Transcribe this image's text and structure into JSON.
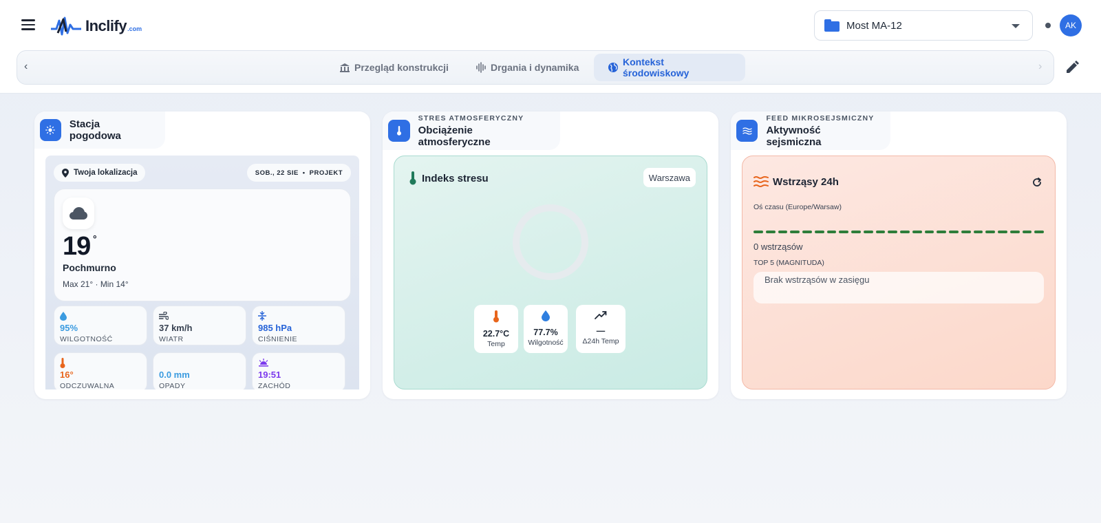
{
  "header": {
    "logo_text": "Inclify",
    "logo_suffix": ".com",
    "project": "Most MA-12",
    "avatar_initials": "AK",
    "accent": "#2f6fe4"
  },
  "tabs": [
    {
      "label": "Przegląd konstrukcji",
      "icon": "building-icon",
      "active": false
    },
    {
      "label": "Drgania i dynamika",
      "icon": "waveform-icon",
      "active": false
    },
    {
      "label": "Kontekst środowiskowy",
      "icon": "globe-icon",
      "active": true
    }
  ],
  "weather_card": {
    "title": "Stacja pogodowa",
    "location": "Twoja lokalizacja",
    "date": "SOB., 22 SIE",
    "mode": "PROJEKT",
    "temperature": "19",
    "degree": "°",
    "condition": "Pochmurno",
    "minmax": "Max 21° · Min 14°",
    "stats": [
      {
        "value": "95%",
        "label": "WILGOTNOŚĆ",
        "icon": "droplet-icon",
        "color": "#3b9be0"
      },
      {
        "value": "37 km/h",
        "label": "WIATR",
        "icon": "wind-icon",
        "color": "#374151"
      },
      {
        "value": "985 hPa",
        "label": "CIŚNIENIE",
        "icon": "pressure-icon",
        "color": "#2663d8"
      },
      {
        "value": "16°",
        "label": "ODCZUWALNA",
        "icon": "thermometer-icon",
        "color": "#e8651c"
      },
      {
        "value": "0.0 mm",
        "label": "OPADY",
        "icon": "rain-icon",
        "color": "#3b9be0"
      },
      {
        "value": "19:51",
        "label": "ZACHÓD",
        "icon": "sunset-icon",
        "color": "#7c3aed"
      }
    ]
  },
  "stress_card": {
    "kicker": "STRES ATMOSFERYCZNY",
    "title": "Obciążenie atmosferyczne",
    "panel_title": "Indeks stresu",
    "city": "Warszawa",
    "metrics": [
      {
        "value": "22.7°C",
        "label": "Temp",
        "icon": "thermometer-icon"
      },
      {
        "value": "77.7%",
        "label": "Wilgotność",
        "icon": "droplet-icon"
      },
      {
        "value": "—",
        "label": "Δ24h Temp",
        "icon": "trend-icon"
      }
    ]
  },
  "seismic_card": {
    "kicker": "FEED MIKROSEJSMICZNY",
    "title": "Aktywność sejsmiczna",
    "panel_title": "Wstrząsy 24h",
    "timeline_label": "Oś czasu (Europe/Warsaw)",
    "count": "0 wstrząsów",
    "top_label": "TOP 5 (MAGNITUDA)",
    "empty_text": "Brak wstrząsów w zasięgu"
  }
}
